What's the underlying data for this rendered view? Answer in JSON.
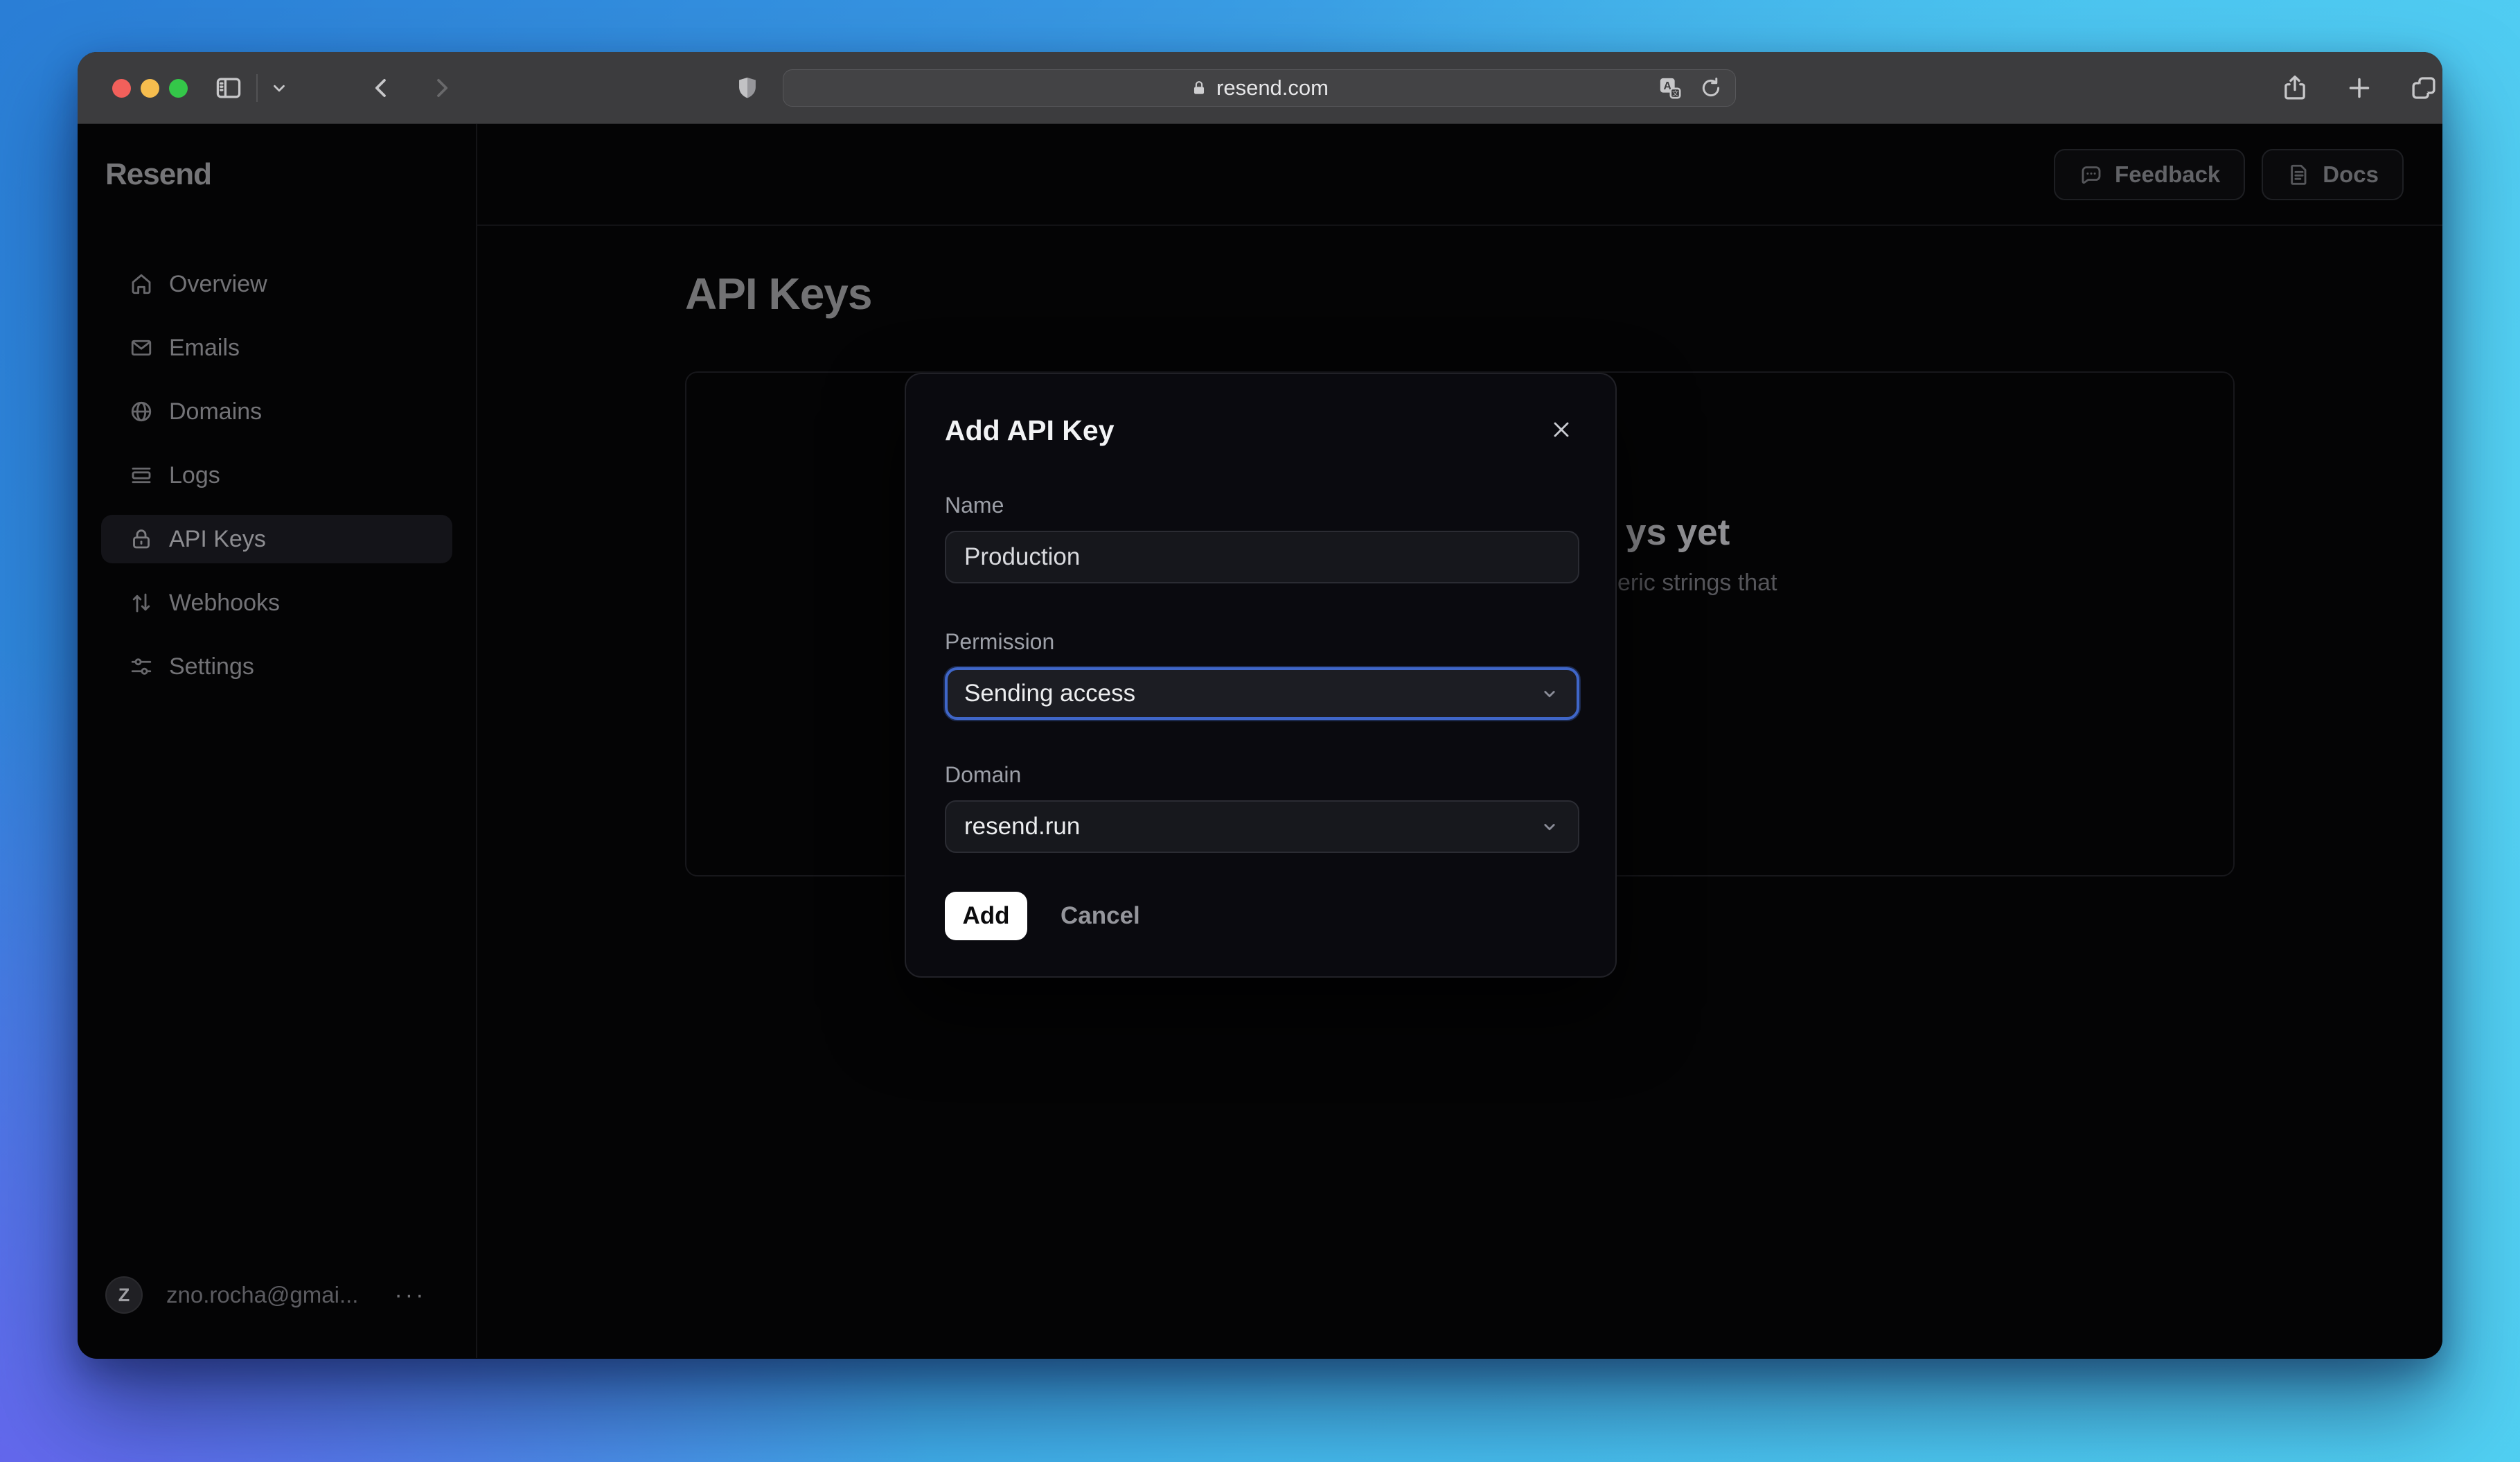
{
  "browser": {
    "url": "resend.com"
  },
  "app": {
    "logo": "Resend",
    "sidebar": {
      "items": [
        {
          "label": "Overview",
          "active": false
        },
        {
          "label": "Emails",
          "active": false
        },
        {
          "label": "Domains",
          "active": false
        },
        {
          "label": "Logs",
          "active": false
        },
        {
          "label": "API Keys",
          "active": true
        },
        {
          "label": "Webhooks",
          "active": false
        },
        {
          "label": "Settings",
          "active": false
        }
      ]
    },
    "user": {
      "initial": "Z",
      "email": "zno.rocha@gmai...",
      "menu_glyph": "···"
    },
    "header": {
      "feedback_label": "Feedback",
      "docs_label": "Docs"
    },
    "page": {
      "title": "API Keys",
      "empty_state": {
        "heading_visible_fragment": "ys yet",
        "description_visible_fragment": "eric strings that"
      }
    }
  },
  "modal": {
    "title": "Add API Key",
    "name_label": "Name",
    "name_value": "Production",
    "permission_label": "Permission",
    "permission_value": "Sending access",
    "domain_label": "Domain",
    "domain_value": "resend.run",
    "add_label": "Add",
    "cancel_label": "Cancel"
  },
  "colors": {
    "accent_focus_ring": "#3f66c8",
    "traffic_red": "#f2605b",
    "traffic_yellow": "#f6bd4e",
    "traffic_green": "#34c749",
    "desktop_blue": "#2a7ed6",
    "desktop_cyan": "#4ecdf1",
    "desktop_purple": "#715cf0",
    "toolbar_gray": "#3c3c3e",
    "app_background": "#040405",
    "modal_background": "#0a0a0f"
  }
}
